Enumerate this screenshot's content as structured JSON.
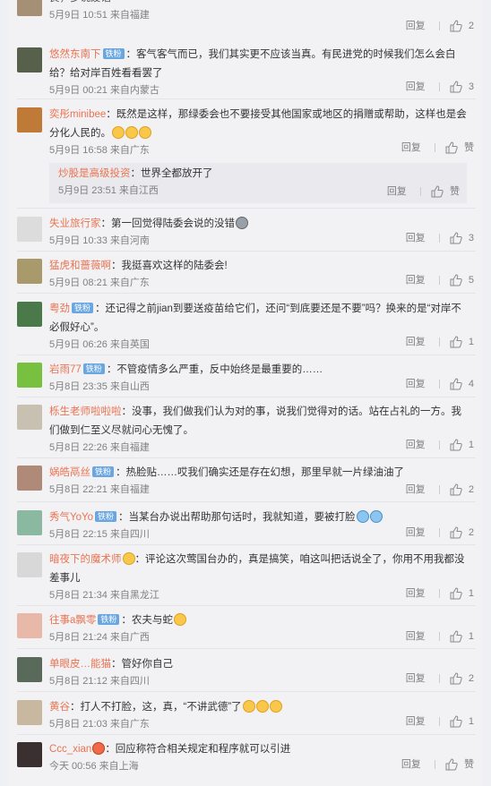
{
  "comments": [
    {
      "user": "",
      "text": "良，多说废话",
      "time": "5月9日 10:51 来自福建",
      "reply": "回复",
      "likes": "2"
    },
    {
      "user": "悠然东南下",
      "vip": "铁粉",
      "text": "：客气客气而已，我们其实更不应该当真。有民进党的时候我们怎么会白给？给对岸百姓看看罢了",
      "time": "5月9日 00:21 来自内蒙古",
      "reply": "回复",
      "likes": "3"
    },
    {
      "user": "奕彤minibee",
      "text": "：既然是这样，那绿委会也不要接受其他国家或地区的捐赠或帮助，这样也是会分化人民的。",
      "time": "5月9日 16:58 来自广东",
      "reply": "回复",
      "likes": "赞"
    },
    {
      "user": "炒股是高级投资",
      "text": "：世界全都放开了",
      "time": "5月9日 23:51 来自江西",
      "reply": "回复",
      "likes": "赞"
    },
    {
      "user": "失业旅行家",
      "text": "：第一回觉得陆委会说的没错",
      "time": "5月9日 10:33 来自河南",
      "reply": "回复",
      "likes": "3"
    },
    {
      "user": "猛虎和蔷薇啊",
      "text": "：我挺喜欢这样的陆委会!",
      "time": "5月9日 08:21 来自广东",
      "reply": "回复",
      "likes": "5"
    },
    {
      "user": "粤劲",
      "vip": "铁粉",
      "text": "：还记得之前jian到要送疫苗给它们，还问“到底要还是不要”吗？换来的是“对岸不必假好心”。",
      "time": "5月9日 06:26 来自英国",
      "reply": "回复",
      "likes": "1"
    },
    {
      "user": "岩雨77",
      "vip": "铁粉",
      "text": "：不管疫情多么严重，反中始终是最重要的……",
      "time": "5月8日 23:35 来自山西",
      "reply": "回复",
      "likes": "4"
    },
    {
      "user": "栎生老师啦啦啦",
      "text": "：没事，我们做我们认为对的事，说我们觉得对的话。站在占礼的一方。我们做到仁至义尽就问心无愧了。",
      "time": "5月8日 22:26 来自福建",
      "reply": "回复",
      "likes": "1"
    },
    {
      "user": "娲皓鬲丝",
      "vip": "铁粉",
      "text": "：热脸贴……哎我们确实还是存在幻想，那里早就一片绿油油了",
      "time": "5月8日 22:21 来自福建",
      "reply": "回复",
      "likes": "2"
    },
    {
      "user": "秀气YoYo",
      "vip": "铁粉",
      "text": "：当某台办说出帮助那句话时，我就知道，要被打脸",
      "time": "5月8日 22:15 来自四川",
      "reply": "回复",
      "likes": "2"
    },
    {
      "user": "暗夜下的魔术师",
      "text": "：评论这次莺国台办的，真是搞笑，咱这叫把话说全了，你用不用我都没差事儿",
      "time": "5月8日 21:34 来自黑龙江",
      "reply": "回复",
      "likes": "1"
    },
    {
      "user": "往事a飘零",
      "vip": "铁粉",
      "text": "：农夫与蛇",
      "time": "5月8日 21:24 来自广西",
      "reply": "回复",
      "likes": "1"
    },
    {
      "user": "单眼皮…能猫",
      "text": "：管好你自己",
      "time": "5月8日 21:12 来自四川",
      "reply": "回复",
      "likes": "2"
    },
    {
      "user": "黄谷",
      "text": "：打人不打脸，这，真，“不讲武德”了",
      "time": "5月8日 21:03 来自广东",
      "reply": "回复",
      "likes": "1"
    },
    {
      "user": "Ccc_xian",
      "text": "：回应称符合相关规定和程序就可以引进",
      "time": "今天 00:56 来自上海",
      "reply": "回复",
      "likes": "赞"
    }
  ],
  "colors": {
    "username": "#eb7350",
    "vip_badge": "#6aa6e0",
    "meta": "#808080",
    "panel": "#f2f2f5"
  },
  "icons": {
    "like": "thumbs-up-icon",
    "emoji": "smiley-emoji"
  }
}
